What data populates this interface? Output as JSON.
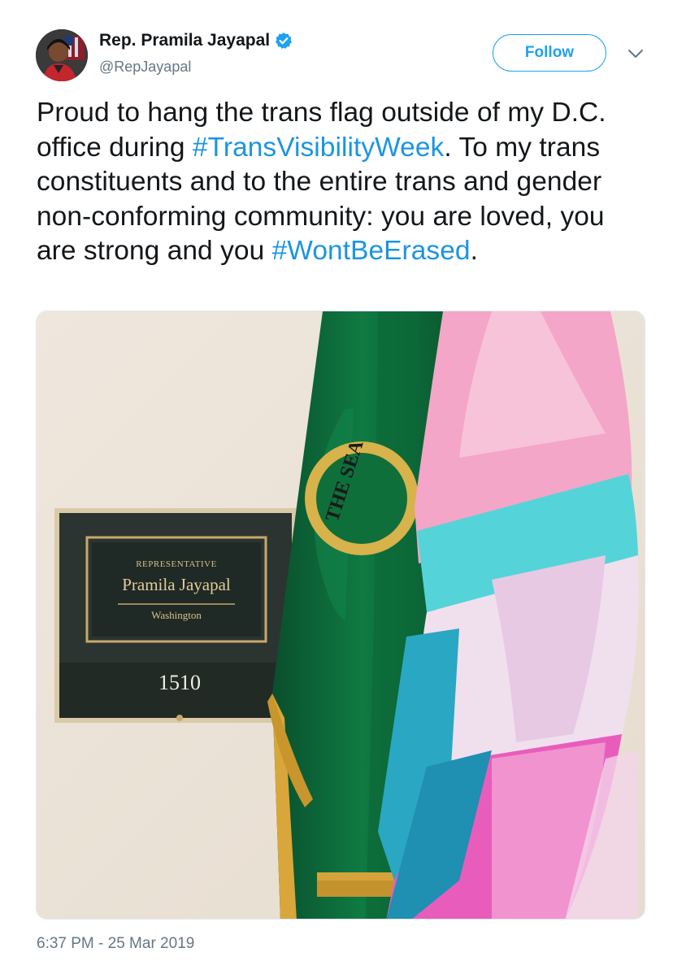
{
  "author": {
    "display_name": "Rep. Pramila Jayapal",
    "handle": "@RepJayapal",
    "verified": true,
    "avatar_icon": "profile-photo",
    "verified_icon": "verified-badge-icon"
  },
  "actions": {
    "follow_label": "Follow",
    "more_icon": "chevron-down-icon"
  },
  "tweet": {
    "segments": [
      {
        "text": "Proud to hang the trans flag outside of my D.C. office during ",
        "type": "text"
      },
      {
        "text": "#TransVisibilityWeek",
        "type": "hashtag"
      },
      {
        "text": ". To my trans constituents and to the entire trans and gender non-conforming community: you are loved, you are strong and you ",
        "type": "text"
      },
      {
        "text": "#WontBeErased",
        "type": "hashtag"
      },
      {
        "text": ".",
        "type": "text"
      }
    ]
  },
  "photo": {
    "plaque": {
      "title": "REPRESENTATIVE",
      "name": "Pramila Jayapal",
      "state": "Washington",
      "room": "1510"
    },
    "seal_text": "THE SEA"
  },
  "timestamp": "6:37 PM - 25 Mar 2019",
  "colors": {
    "link": "#1b95e0",
    "follow_border": "#1da1f2",
    "secondary_text": "#657786",
    "trans_blue": "#5bcefa",
    "trans_pink": "#f5a9b8",
    "wa_flag_green": "#0b6b3a"
  }
}
